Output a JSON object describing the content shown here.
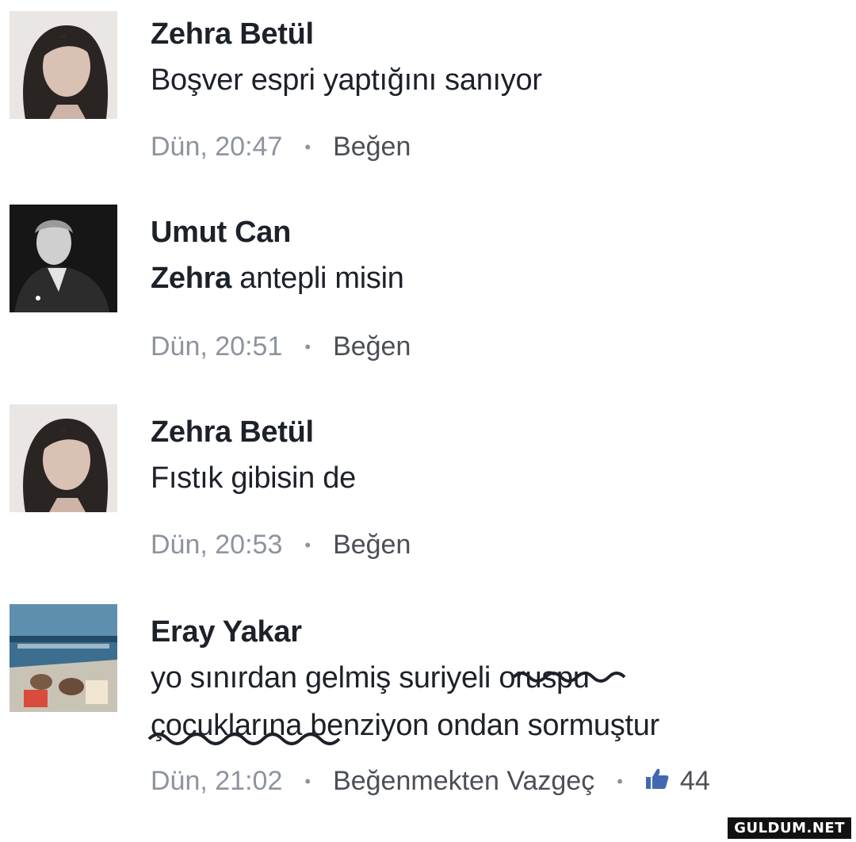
{
  "comments": [
    {
      "author": "Zehra Betül",
      "text": "Boşver espri yaptığını sanıyor",
      "time": "Dün, 20:47",
      "like_label": "Beğen"
    },
    {
      "author": "Umut Can",
      "mention": "Zehra",
      "text": " antepli misin",
      "time": "Dün, 20:51",
      "like_label": "Beğen"
    },
    {
      "author": "Zehra Betül",
      "text": "Fıstık gibisin de",
      "time": "Dün, 20:53",
      "like_label": "Beğen"
    },
    {
      "author": "Eray Yakar",
      "line1_prefix": "yo sınırdan gelmiş suriyeli o",
      "line1_struck": "ruspu",
      "line2_struck": "çocuklarına",
      "line2_suffix": " benziyon ondan sormuştur",
      "time": "Dün, 21:02",
      "like_label": "Beğenmekten Vazgeç",
      "like_count": "44"
    }
  ],
  "watermark": "GULDUM.NET",
  "colors": {
    "text": "#1d2129",
    "meta": "#8d949e",
    "like": "#4b4f56",
    "thumb": "#4267b2"
  },
  "icons": {
    "dot": "bullet",
    "thumb": "thumbs-up-icon"
  }
}
